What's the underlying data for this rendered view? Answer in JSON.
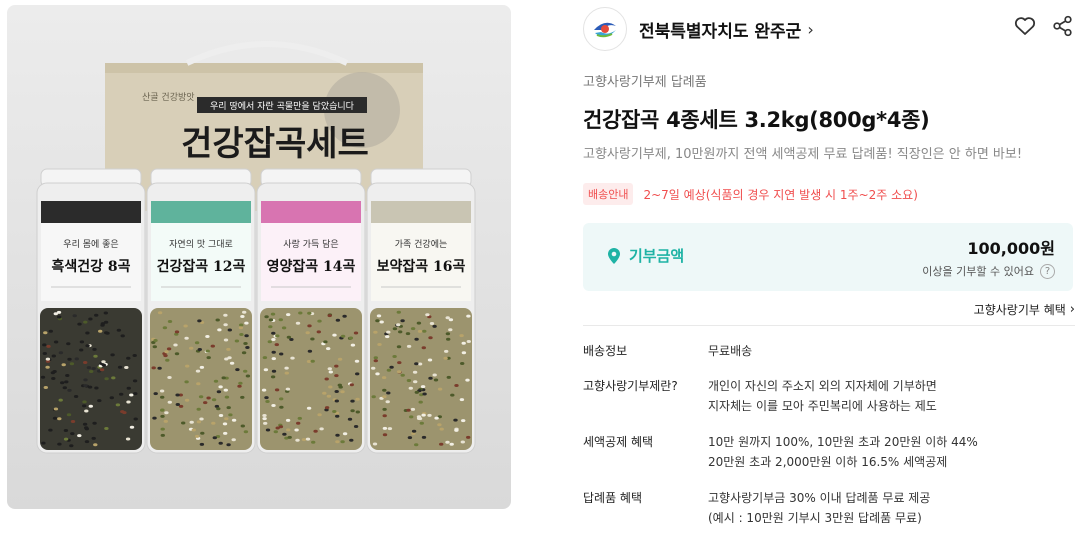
{
  "product_image": {
    "box_heading": "건강잡곡세트",
    "box_tagline": "우리 땅에서 자란 곡물만을 담았습니다",
    "box_logo": "산골 건강방앗",
    "jars": [
      {
        "tagline": "우리 몸에 좋은",
        "name": "흑색건강 8곡",
        "band_color": "#2b2b2b",
        "tint": "#f7f7f7"
      },
      {
        "tagline": "자연의 맛 그대로",
        "name": "건강잡곡 12곡",
        "band_color": "#5fb39c",
        "tint": "#f3fbf8"
      },
      {
        "tagline": "사랑 가득 담은",
        "name": "영양잡곡 14곡",
        "band_color": "#d874b1",
        "tint": "#fcf1f8"
      },
      {
        "tagline": "가족 건강에는",
        "name": "보약잡곡 16곡",
        "band_color": "#c9c5b3",
        "tint": "#f8f7f2"
      }
    ]
  },
  "seller": {
    "name": "전북특별자치도 완주군",
    "chevron": "›"
  },
  "category": "고향사랑기부제 답례품",
  "title": "건강잡곡 4종세트 3.2kg(800g*4종)",
  "subtitle": "고향사랑기부제, 10만원까지 전액 세액공제 무료 답례품! 직장인은 안 하면 바보!",
  "shipping": {
    "badge": "배송안내",
    "text": "2~7일 예상(식품의 경우 지연 발생 시 1주~2주 소요)"
  },
  "donation": {
    "label": "기부금액",
    "amount": "100,000원",
    "note": "이상을 기부할 수 있어요",
    "help": "?"
  },
  "benefit_link": "고향사랑기부 혜택",
  "specs": [
    {
      "key": "배송정보",
      "lines": [
        "무료배송"
      ]
    },
    {
      "key": "고향사랑기부제란?",
      "lines": [
        "개인이 자신의 주소지 외의 지자체에 기부하면",
        "지자체는 이를 모아 주민복리에 사용하는 제도"
      ]
    },
    {
      "key": "세액공제 혜택",
      "lines": [
        "10만 원까지 100%, 10만원 초과 20만원 이하 44%",
        "20만원 초과 2,000만원 이하 16.5% 세액공제"
      ]
    },
    {
      "key": "답례품 혜택",
      "lines": [
        "고향사랑기부금 30% 이내 답례품 무료 제공",
        "(예시 : 10만원 기부시 3만원 답례품 무료)"
      ]
    }
  ],
  "colors": {
    "accent": "#1fb3a5",
    "shipping_red": "#f04e4e",
    "donate_bg": "#eef8f8"
  },
  "icons": {
    "like": "heart-icon",
    "share": "share-icon",
    "location": "location-pin-icon",
    "help": "question-icon"
  }
}
